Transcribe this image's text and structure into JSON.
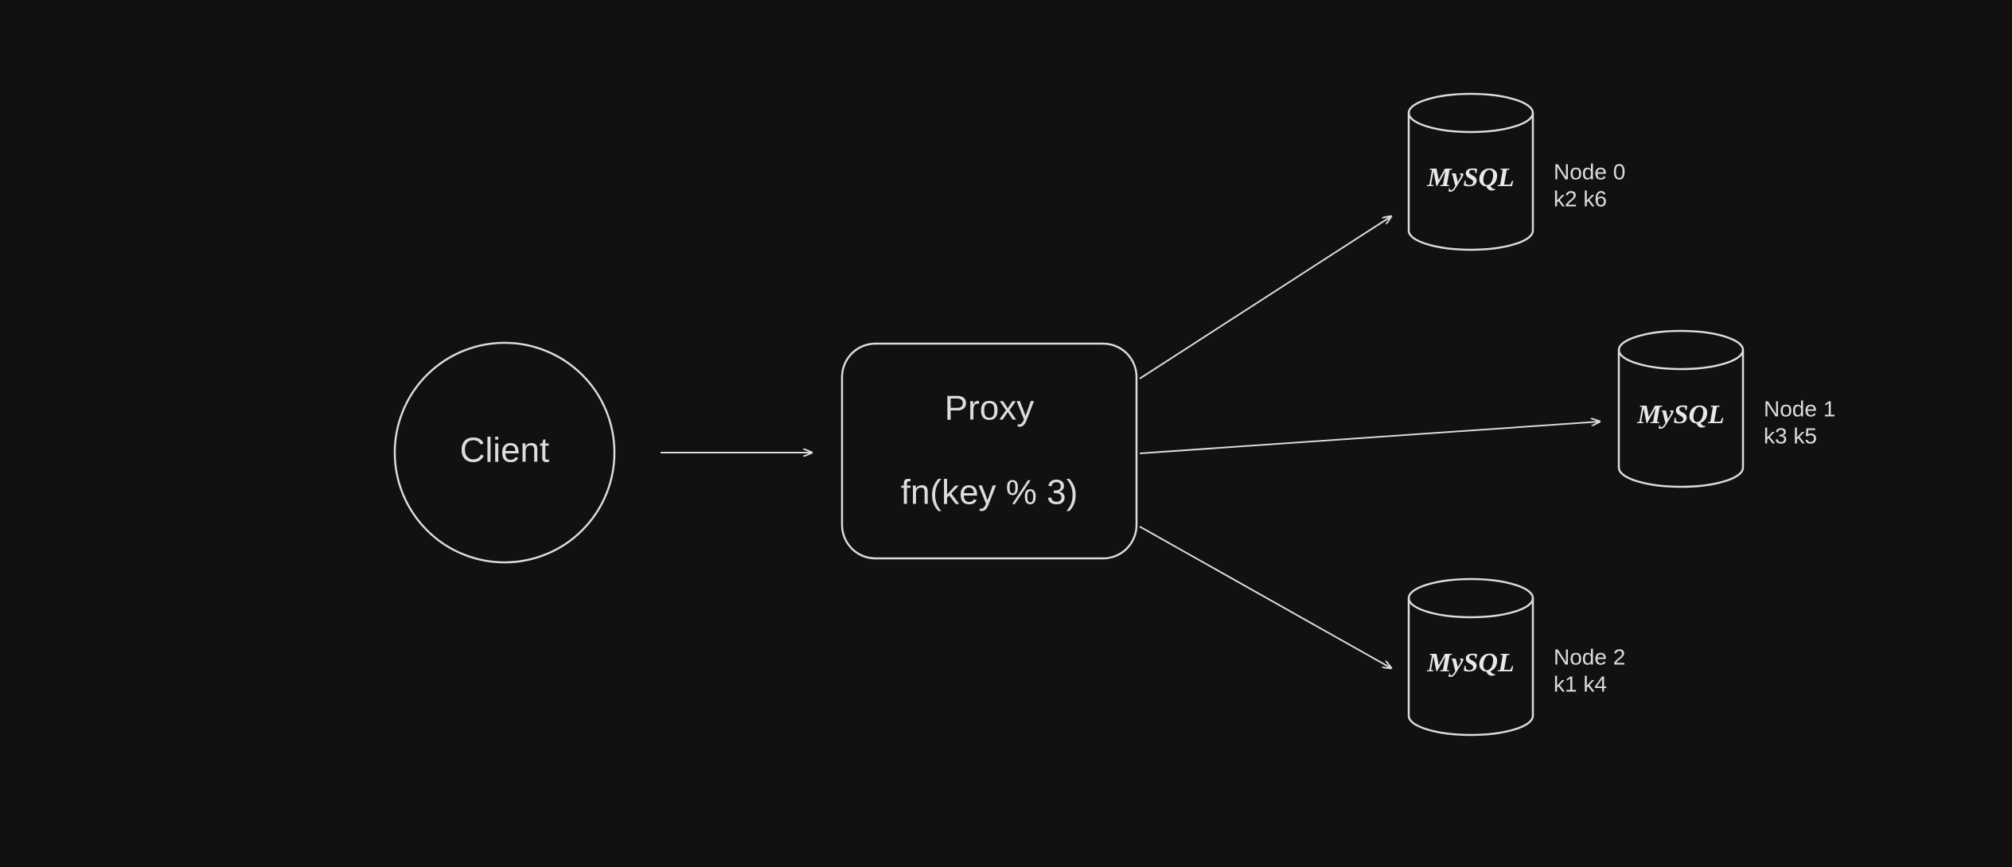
{
  "client": {
    "label": "Client"
  },
  "proxy": {
    "title": "Proxy",
    "fn": "fn(key % 3)"
  },
  "db_engine": "MySQL",
  "nodes": [
    {
      "name": "Node 0",
      "keys": "k2 k6"
    },
    {
      "name": "Node 1",
      "keys": "k3 k5"
    },
    {
      "name": "Node 2",
      "keys": "k1 k4"
    }
  ]
}
